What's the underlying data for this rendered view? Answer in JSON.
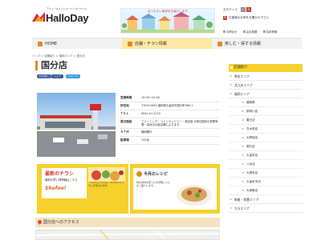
{
  "header": {
    "tagline": "アミューズメントスーパーマーケット",
    "logo": "HalloDay",
    "banner_text": "あったかい食卓をお届けします",
    "font_size_label": "文字サイズ",
    "font_size_small": "小",
    "font_size_large": "大",
    "notice": "お客様のお声をお聞かせ下さい",
    "sublinks": [
      "お問合せ",
      "会社概要",
      "採用情報"
    ]
  },
  "nav": [
    {
      "label": "HOME",
      "icon": "home-icon"
    },
    {
      "label": "店舗・チラシ情報",
      "icon": "shop-icon"
    },
    {
      "label": "楽しむ・得する情報",
      "icon": "star-icon"
    }
  ],
  "breadcrumb": "トップ > 店舗紹介 > 福岡エリア > 国分店",
  "page": {
    "title": "国分店",
    "share_buttons": [
      "いいね！",
      "シェア",
      "ツイート"
    ]
  },
  "store_info": [
    {
      "key": "営業時間",
      "value": "10:00～22:00"
    },
    {
      "key": "所在地",
      "value": "〒839-0863 福岡県久留米市国分町980-1"
    },
    {
      "key": "ＴＥＬ",
      "value": "0942-51-2210"
    },
    {
      "key": "周辺施設",
      "value": "クリーニング・コインランドリー・美容室 ※周辺施設の営業時間・定休日は各店舗によります。"
    },
    {
      "key": "ＡＴＭ",
      "value": "福岡銀行"
    },
    {
      "key": "駐車場",
      "value": "132台"
    }
  ],
  "promo": {
    "chirashi_title": "最新のチラシ",
    "chirashi_sub": "最新お買い得情報はこちら",
    "shufoo": "Shufoo!",
    "shufoo_note": "「いいシュフさん」Shufoo!でチラシが見られます",
    "recipe_title": "今月のレシピ",
    "recipe_text": "旬の食材を使ったお手軽レシピをご紹介します。"
  },
  "access_title": "国分店へのアクセス",
  "sidebar": {
    "title": "店舗紹介",
    "areas_top": [
      "熊本エリア",
      "北九州エリア",
      "福岡エリア"
    ],
    "stores": [
      "福岡県",
      "那珂川店",
      "春日店",
      "白木原店",
      "大野城店",
      "国分店",
      "久留米店",
      "八女店",
      "大城寺店",
      "久留米市店",
      "大城東店"
    ],
    "areas_bottom": [
      "筑後・筑豊エリア",
      "大分エリア"
    ]
  },
  "colors": {
    "accent_yellow": "#f6d12b",
    "brand_red": "#d23a2b",
    "title_bar": "#e28a18"
  }
}
